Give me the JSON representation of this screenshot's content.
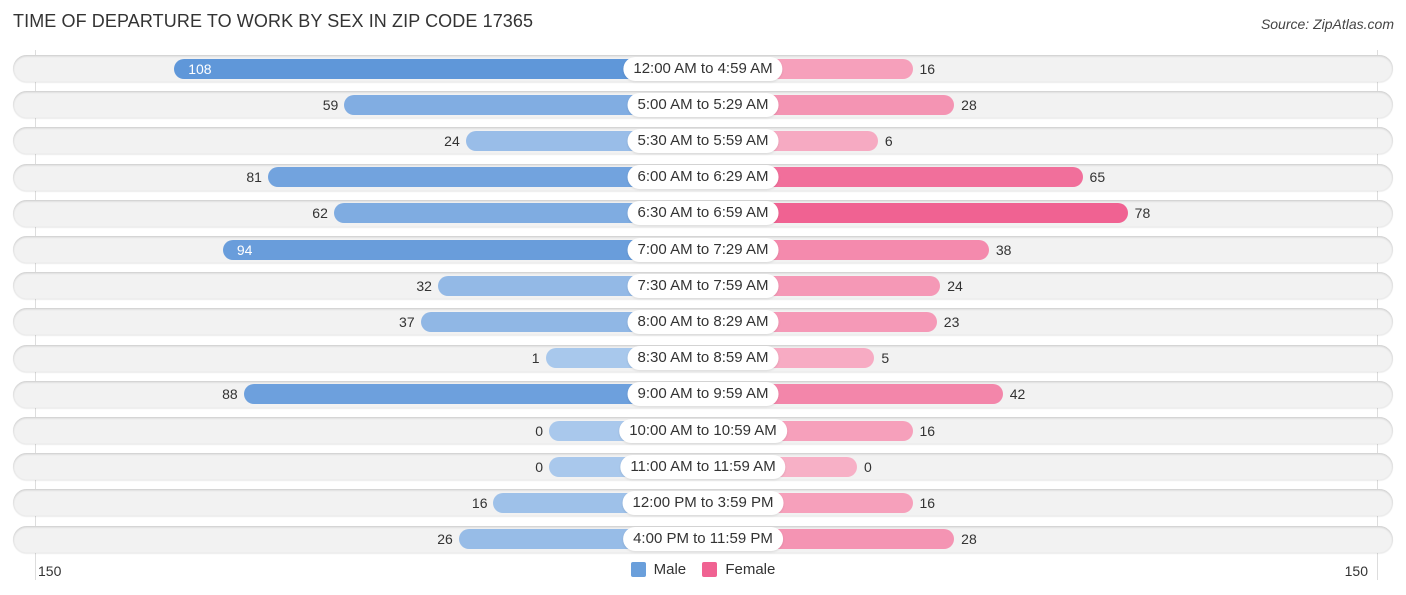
{
  "title": "TIME OF DEPARTURE TO WORK BY SEX IN ZIP CODE 17365",
  "source": "Source: ZipAtlas.com",
  "chart_data": {
    "type": "bar",
    "orientation": "horizontal-diverging",
    "title": "TIME OF DEPARTURE TO WORK BY SEX IN ZIP CODE 17365",
    "categories": [
      "12:00 AM to 4:59 AM",
      "5:00 AM to 5:29 AM",
      "5:30 AM to 5:59 AM",
      "6:00 AM to 6:29 AM",
      "6:30 AM to 6:59 AM",
      "7:00 AM to 7:29 AM",
      "7:30 AM to 7:59 AM",
      "8:00 AM to 8:29 AM",
      "8:30 AM to 8:59 AM",
      "9:00 AM to 9:59 AM",
      "10:00 AM to 10:59 AM",
      "11:00 AM to 11:59 AM",
      "12:00 PM to 3:59 PM",
      "4:00 PM to 11:59 PM"
    ],
    "series": [
      {
        "name": "Male",
        "color": "#6a9fdb",
        "values": [
          108,
          59,
          24,
          81,
          62,
          94,
          32,
          37,
          1,
          88,
          0,
          0,
          16,
          26
        ]
      },
      {
        "name": "Female",
        "color": "#f06292",
        "values": [
          16,
          28,
          6,
          65,
          78,
          38,
          24,
          23,
          5,
          42,
          16,
          0,
          16,
          28
        ]
      }
    ],
    "xlim": [
      150,
      150
    ],
    "axis_labels": {
      "left": "150",
      "right": "150"
    },
    "legend": {
      "position": "bottom-center",
      "entries": [
        "Male",
        "Female"
      ]
    }
  }
}
